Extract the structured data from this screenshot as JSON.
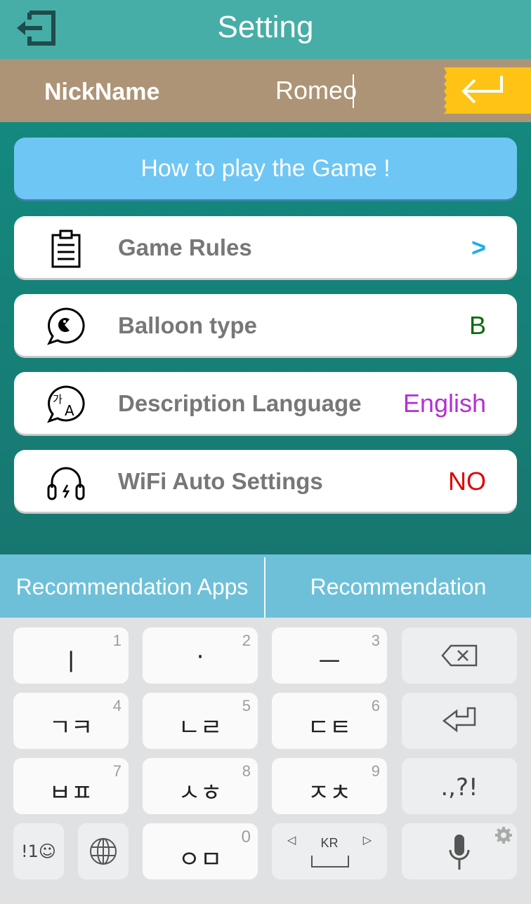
{
  "header": {
    "title": "Setting",
    "back_icon": "exit-icon"
  },
  "nickname": {
    "label": "NickName",
    "value": "Romeo",
    "enter_icon": "enter-arrow-icon",
    "accent": "#fec314"
  },
  "how_to_play": {
    "label": "How to play the Game !"
  },
  "settings": [
    {
      "icon": "clipboard-icon",
      "label": "Game Rules",
      "value": ">",
      "color": "#1eaee8"
    },
    {
      "icon": "balloon-chat-icon",
      "label": "Balloon type",
      "value": "B",
      "color": "#0a6b0a"
    },
    {
      "icon": "translate-icon",
      "label": "Description Language",
      "value": "English",
      "color": "#b42fd2"
    },
    {
      "icon": "headphones-icon",
      "label": "WiFi Auto Settings",
      "value": "NO",
      "color": "#e00000"
    }
  ],
  "recommendation": {
    "apps_label": "Recommendation Apps",
    "other_label": "Recommendation"
  },
  "keyboard": {
    "rows": [
      [
        {
          "glyph": "ㅣ",
          "num": "1"
        },
        {
          "glyph": "·",
          "num": "2"
        },
        {
          "glyph": "ㅡ",
          "num": "3"
        },
        {
          "glyph": "",
          "icon": "backspace-icon"
        }
      ],
      [
        {
          "glyph": "ㄱㅋ",
          "num": "4"
        },
        {
          "glyph": "ㄴㄹ",
          "num": "5"
        },
        {
          "glyph": "ㄷㅌ",
          "num": "6"
        },
        {
          "glyph": "",
          "icon": "enter-icon"
        }
      ],
      [
        {
          "glyph": "ㅂㅍ",
          "num": "7"
        },
        {
          "glyph": "ㅅㅎ",
          "num": "8"
        },
        {
          "glyph": "ㅈㅊ",
          "num": "9"
        },
        {
          "glyph": ".,?!"
        }
      ]
    ],
    "bottom": {
      "symbols": "!1☺",
      "globe_icon": "globe-icon",
      "zero_glyph": "ㅇㅁ",
      "zero_num": "0",
      "lang": "KR",
      "mic_icon": "microphone-icon",
      "settings_icon": "gear-icon"
    }
  }
}
